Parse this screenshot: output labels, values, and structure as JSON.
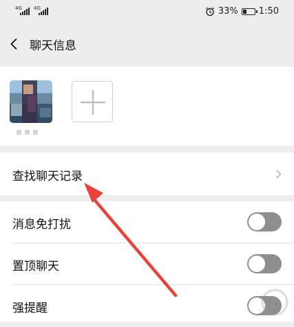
{
  "status_bar": {
    "network_1": "4G",
    "network_2": "4G",
    "battery_percent": "33%",
    "battery_level": 0.33,
    "time": "1:50"
  },
  "header": {
    "back_icon": "chevron-left-icon",
    "title": "聊天信息"
  },
  "members": {
    "add_icon": "plus-icon"
  },
  "search_history": {
    "label": "查找聊天记录",
    "chevron_icon": "chevron-right-icon"
  },
  "settings": [
    {
      "label": "消息免打扰",
      "enabled": false
    },
    {
      "label": "置顶聊天",
      "enabled": false
    },
    {
      "label": "强提醒",
      "enabled": false
    }
  ],
  "annotation": {
    "arrow_color": "#e8423c"
  },
  "colors": {
    "background": "#ededed",
    "toggle_off": "#8e8e8e"
  }
}
